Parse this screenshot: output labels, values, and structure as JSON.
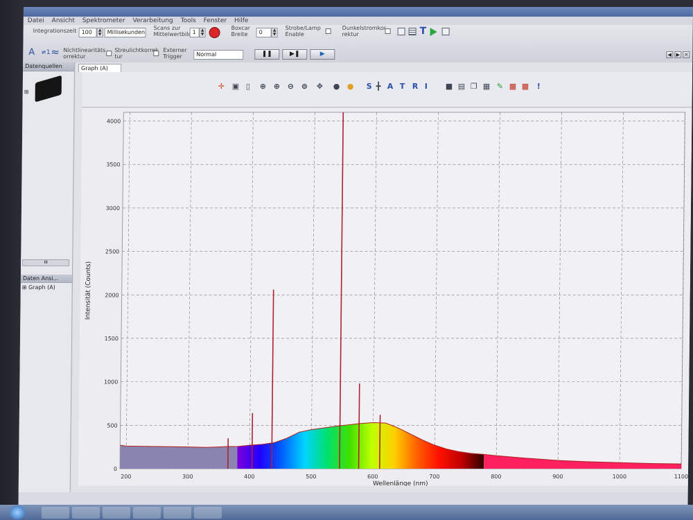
{
  "app": {
    "menu": [
      "Datei",
      "Ansicht",
      "Spektrometer",
      "Verarbeitung",
      "Tools",
      "Fenster",
      "Hilfe"
    ]
  },
  "toolbar": {
    "integration_label": "Integrationszeit",
    "integration_value": "100",
    "unit_select": "Millisekunden",
    "scans_label_1": "Scans zur",
    "scans_label_2": "Mittelwertbildu",
    "scans_value": "1",
    "boxcar_label_1": "Boxcar",
    "boxcar_label_2": "Breite",
    "boxcar_value": "0",
    "strobe_label_1": "Strobe/Lamp",
    "strobe_label_2": "Enable",
    "dark_label_1": "Dunkelstromkor",
    "dark_label_2": "rektur",
    "nonlin_label_1": "Nichtlinearitäts",
    "nonlin_label_2": "orrektur",
    "stray_label_1": "Streulichtkorrek",
    "stray_label_2": "tur",
    "trigger_label_1": "Externer",
    "trigger_label_2": "Trigger",
    "trigger_select": "Normal",
    "text_tool": "A",
    "hash_tool": "≠1",
    "wave_tool": "≈"
  },
  "left_panel": {
    "sources_title": "Datenquellen",
    "views_title": "Daten Ansi...",
    "views_item": "Graph (A)",
    "scroll_label": "III"
  },
  "graph": {
    "tab_label": "Graph (A)",
    "tool_letters": [
      "S",
      "A",
      "T",
      "R",
      "I"
    ]
  },
  "chart_data": {
    "type": "line",
    "xlabel": "Wellenlänge (nm)",
    "ylabel": "Intensität (Counts)",
    "xlim": [
      190,
      1100
    ],
    "ylim": [
      0,
      4100
    ],
    "x_ticks": [
      "200",
      "300",
      "400",
      "500",
      "600",
      "700",
      "800",
      "900",
      "1000",
      "1100"
    ],
    "y_ticks": [
      "0",
      "500",
      "1000",
      "1500",
      "2000",
      "2500",
      "3000",
      "3500",
      "4000"
    ],
    "grid": true,
    "series": [
      {
        "x": [
          190,
          200,
          250,
          300,
          330,
          350,
          365,
          380,
          400,
          420,
          440,
          460,
          480,
          500,
          520,
          540,
          560,
          580,
          600,
          620,
          640,
          660,
          680,
          700,
          720,
          740,
          760,
          780,
          800,
          850,
          900,
          950,
          1000,
          1050,
          1100
        ],
        "y": [
          270,
          260,
          255,
          250,
          245,
          250,
          255,
          255,
          270,
          280,
          300,
          350,
          420,
          450,
          470,
          490,
          505,
          520,
          530,
          525,
          470,
          400,
          330,
          270,
          225,
          195,
          175,
          165,
          150,
          120,
          95,
          80,
          70,
          60,
          55
        ]
      }
    ],
    "peaks": [
      {
        "x": 365,
        "y": 350
      },
      {
        "x": 404,
        "y": 640
      },
      {
        "x": 436,
        "y": 2060
      },
      {
        "x": 546,
        "y": 4150
      },
      {
        "x": 577,
        "y": 980
      },
      {
        "x": 611,
        "y": 620
      }
    ],
    "spectrum_colors": [
      "#7c00d8",
      "#2200ff",
      "#0060ff",
      "#00d4ff",
      "#00e070",
      "#40e000",
      "#c0ff00",
      "#ffd000",
      "#ff6000",
      "#ff1000",
      "#c00000",
      "#300000"
    ],
    "uv_color": "#8a84b0",
    "ir_color": "#ff2060"
  }
}
